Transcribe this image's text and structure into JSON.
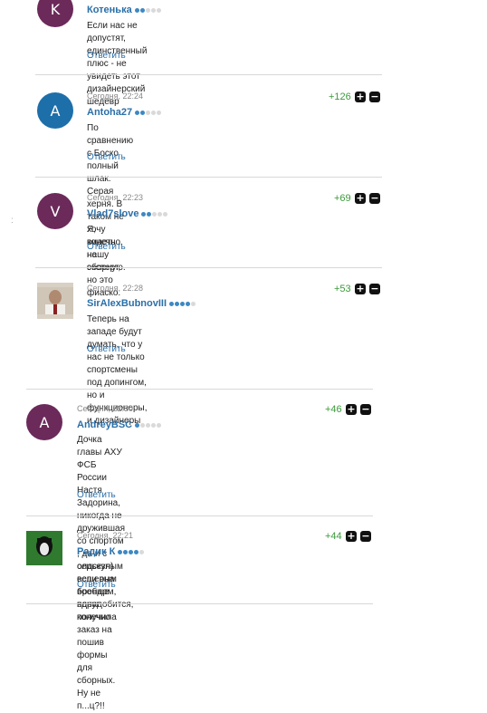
{
  "comments": [
    {
      "avatar_letter": "K",
      "avatar_color": "#6b2a5a",
      "time": "",
      "author": "Котенька",
      "rating": 2,
      "text_lines": [
        "Если нас не допустят, единственный плюс - не увидеть этот",
        "дизайнерский шедевр"
      ],
      "reply": "Ответить",
      "score": "",
      "apple": false
    },
    {
      "avatar_letter": "A",
      "avatar_color": "#1d6faa",
      "time": "Сегодня, 22:24",
      "author": "Antoha27",
      "rating": 2,
      "text_lines": [
        "По сравнению с Боско полный шлак. Серая херня. В таком не",
        "хочу видеть нашу сборную."
      ],
      "reply": "Ответить",
      "score": "+126",
      "apple": false
    },
    {
      "avatar_letter": "V",
      "avatar_color": "#6b2a5a",
      "time": "Сегодня, 22:23",
      "author": "Vlad7slove",
      "rating": 2,
      "text_lines": [
        "Я, конечно, не эксперт, но это фиаско."
      ],
      "reply": "Ответить",
      "score": "+69",
      "apple": false
    },
    {
      "avatar_letter": "",
      "avatar_color": "#a89a86",
      "time": "Сегодня, 22:28",
      "author": "SirAlexBubnovIII",
      "rating": 4,
      "text_lines": [
        "Теперь на западе будут думать, что у нас не только спортсмены",
        "под допингом, но и функционеры, и дизайнеры"
      ],
      "reply": "Ответить",
      "score": "+53",
      "apple": true
    },
    {
      "avatar_letter": "A",
      "avatar_color": "#6b2a5a",
      "time": "Сегодня, 22:30",
      "author": "AndreyBSC",
      "rating": 1,
      "text_lines": [
        "Дочка главы АХУ ФСБ России Настя Задорина, никогда не",
        "дружившая со спортом , да и с серьезным вещевым брендом,",
        "вдруг получила заказ на пошив формы для сборных. Ну не",
        "п...ц?!!"
      ],
      "reply": "Ответить",
      "score": "+46",
      "apple": true
    },
    {
      "avatar_letter": "",
      "avatar_color": "#2f7a2f",
      "time": "Сегодня, 22:21",
      "author": "Радик К",
      "rating": 4,
      "text_lines": [
        "олдскул) если она вообще понадобится, конечно"
      ],
      "reply": "Ответить",
      "score": "+44",
      "apple": false
    }
  ],
  "vote_up": "+",
  "vote_down": "−",
  "side_mark": ":"
}
